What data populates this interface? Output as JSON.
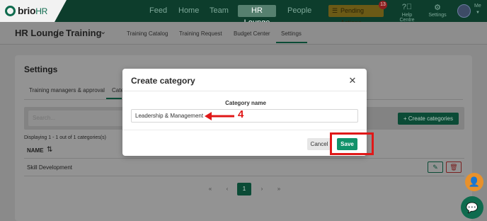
{
  "app": {
    "logo_name": "brio",
    "logo_suffix": "HR"
  },
  "topnav": {
    "items": [
      "Feed",
      "Home",
      "Team",
      "HR Lounge",
      "People"
    ],
    "active": "HR Lounge",
    "pending_label": "Pending Actions",
    "pending_count": "13",
    "help_label": "Help Centre",
    "settings_label": "Settings",
    "user_label": "Me"
  },
  "breadcrumb": {
    "root": "HR Lounge",
    "separator": "/",
    "current": "Training"
  },
  "subtabs": [
    "Training Catalog",
    "Training Request",
    "Budget Center",
    "Settings"
  ],
  "settings": {
    "title": "Settings",
    "tabs": [
      "Training managers & approval",
      "Cate"
    ],
    "search_placeholder": "Search...",
    "create_label": "+ Create categories",
    "displaying": "Displaying 1 - 1 out of 1 categories(s)",
    "column_name": "NAME",
    "rows": [
      "Skill Development"
    ],
    "pagination": [
      "«",
      "‹",
      "1",
      "›",
      "»"
    ],
    "current_page": "1"
  },
  "modal": {
    "title": "Create category",
    "field_label": "Category name",
    "field_value": "Leadership & Management",
    "cancel_label": "Cancel",
    "save_label": "Save"
  },
  "annotation": {
    "step": "4",
    "color": "#e01818"
  },
  "colors": {
    "brand": "#0f6b4e",
    "save": "#11926a",
    "highlight": "#e01818"
  }
}
